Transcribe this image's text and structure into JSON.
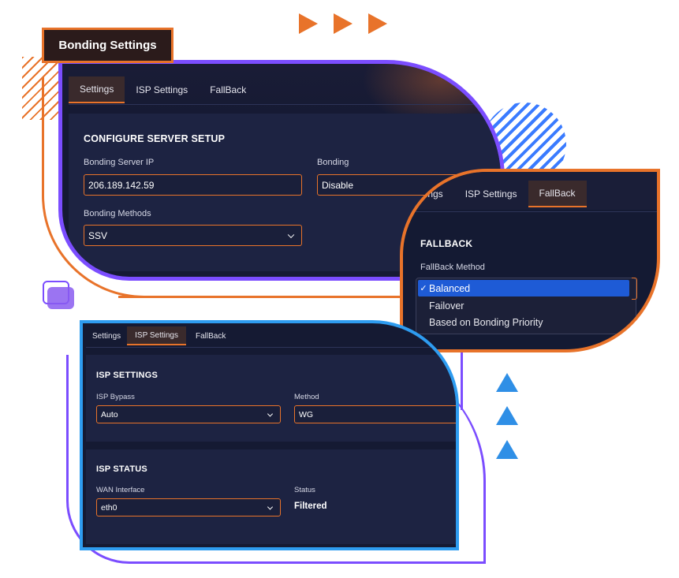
{
  "title": "Bonding Settings",
  "panel_settings": {
    "tabs": [
      "Settings",
      "ISP Settings",
      "FallBack"
    ],
    "active_tab": "Settings",
    "section_heading": "CONFIGURE SERVER SETUP",
    "bonding_server_ip": {
      "label": "Bonding Server IP",
      "value": "206.189.142.59"
    },
    "bonding": {
      "label": "Bonding",
      "value": "Disable"
    },
    "bonding_methods": {
      "label": "Bonding Methods",
      "value": "SSV"
    }
  },
  "panel_fallback": {
    "tabs": [
      "ttings",
      "ISP Settings",
      "FallBack"
    ],
    "active_tab": "FallBack",
    "section_heading": "FALLBACK",
    "fallback_method_label": "FallBack Method",
    "options": [
      {
        "label": "Balanced",
        "selected": true,
        "check": "✓"
      },
      {
        "label": "Failover",
        "selected": false
      },
      {
        "label": "Based on Bonding Priority",
        "selected": false
      }
    ]
  },
  "panel_isp": {
    "tabs": [
      "Settings",
      "ISP Settings",
      "FallBack"
    ],
    "active_tab": "ISP Settings",
    "isp_settings_heading": "ISP SETTINGS",
    "isp_bypass": {
      "label": "ISP Bypass",
      "value": "Auto"
    },
    "method": {
      "label": "Method",
      "value": "WG"
    },
    "isp_status_heading": "ISP STATUS",
    "wan_interface": {
      "label": "WAN Interface",
      "value": "eth0"
    },
    "status": {
      "label": "Status",
      "value": "Filtered"
    }
  },
  "colors": {
    "accent_orange": "#e8732a",
    "accent_purple": "#7b4dff",
    "accent_blue": "#2f8fe6",
    "panel_bg": "#151a33",
    "selection_blue": "#1e5bd6"
  },
  "icons": [
    "chevron-down-icon",
    "check-icon",
    "play-arrow-icon",
    "triangle-up-icon"
  ]
}
